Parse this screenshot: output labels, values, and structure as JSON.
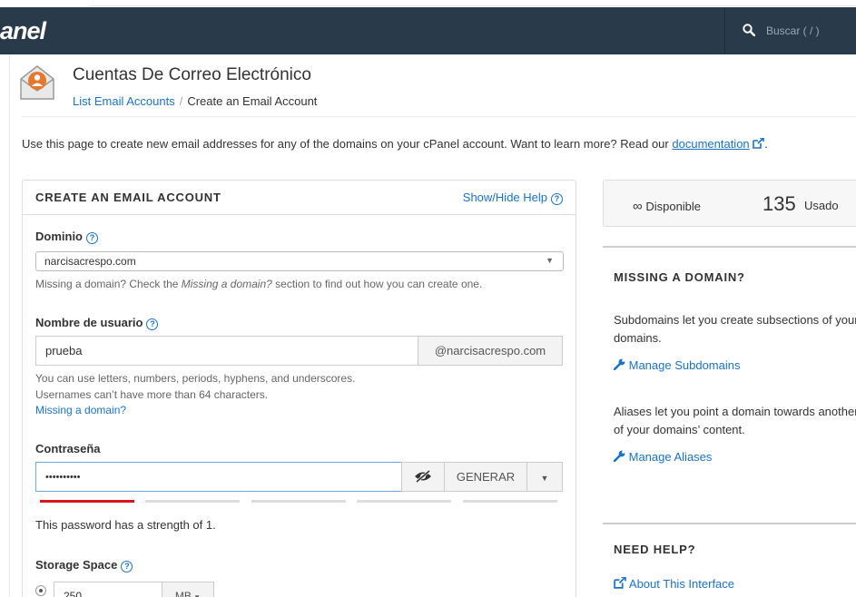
{
  "header": {
    "logo_text": "anel",
    "search_placeholder": "Buscar ( / )"
  },
  "page": {
    "title": "Cuentas De Correo Electrónico",
    "breadcrumb": {
      "parent": "List Email Accounts",
      "separator": "/",
      "current": "Create an Email Account"
    },
    "intro_text": "Use this page to create new email addresses for any of the domains on your cPanel account. Want to learn more? Read our",
    "intro_link": "documentation",
    "intro_end": "."
  },
  "form": {
    "card_title": "CREATE AN EMAIL ACCOUNT",
    "show_hide_help": "Show/Hide Help",
    "domain_label": "Dominio",
    "domain_value": "narcisacrespo.com",
    "domain_help": "Missing a domain? Check the Missing a domain? section to find out how you can create one.",
    "domain_help_a": "Missing a domain? Check the ",
    "domain_help_em": "Missing a domain?",
    "domain_help_b": " section to find out how you can create one.",
    "username_label": "Nombre de usuario",
    "username_value": "prueba",
    "username_suffix": "@narcisacrespo.com",
    "username_help_1": "You can use letters, numbers, periods, hyphens, and underscores.",
    "username_help_2": "Usernames can’t have more than 64 characters.",
    "missing_domain_link": "Missing a domain?",
    "password_label": "Contraseña",
    "password_value": "••••••••••",
    "generate_label": "GENERAR",
    "password_strength_text": "This password has a strength of 1.",
    "password_strength_score": 1,
    "storage_label": "Storage Space",
    "storage_value": "250",
    "storage_unit": "MB"
  },
  "sidebar": {
    "stats": {
      "available_symbol": "∞",
      "available_label": "Disponible",
      "used_count": "135",
      "used_label": "Usado"
    },
    "missing_domain": {
      "title": "MISSING A DOMAIN?",
      "text_1": "Subdomains let you create subsections of your domains.",
      "link_1": "Manage Subdomains",
      "text_2": "Aliases let you point a domain towards another of your domains’ content.",
      "link_2": "Manage Aliases"
    },
    "need_help": {
      "title": "NEED HELP?",
      "link": "About This Interface"
    }
  },
  "colors": {
    "topbar": "#293a4a",
    "link": "#1a73c8",
    "strength_weak": "#d9151b",
    "strength_empty": "#dddddd",
    "email_icon_orange": "#e8772e"
  }
}
